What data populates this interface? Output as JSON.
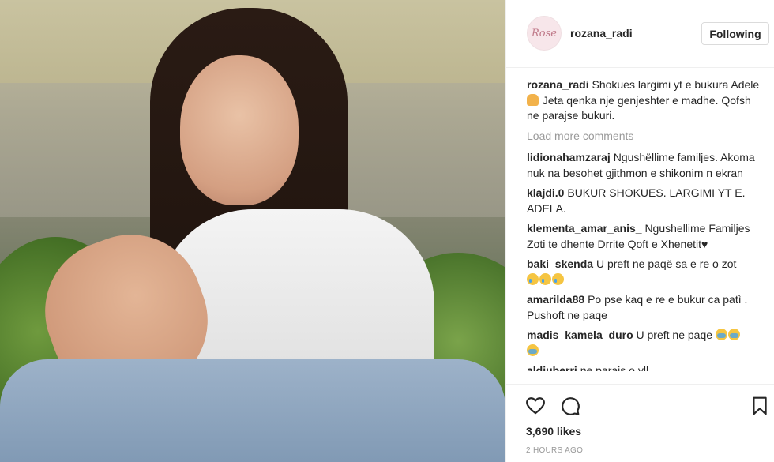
{
  "header": {
    "avatar_text": "Rose",
    "username": "rozana_radi",
    "follow_label": "Following"
  },
  "caption": {
    "author": "rozana_radi",
    "text": "Shokues largimi yt e bukura Adele",
    "text2": "Jeta qenka nje genjeshter e madhe. Qofsh ne parajse bukuri."
  },
  "load_more": "Load more comments",
  "comments": [
    {
      "author": "lidionahamzaraj",
      "text": "Ngushëllime familjes. Akoma nuk na besohet gjithmon e shikonim n ekran"
    },
    {
      "author": "klajdi.0",
      "text": "BUKUR SHOKUES. LARGIMI YT E. ADELA."
    },
    {
      "author": "klementa_amar_anis_",
      "text": "Ngushellime Familjes Zoti te dhente Drrite Qoft e Xhenetit♥"
    },
    {
      "author": "baki_skenda",
      "text": "U preft ne paqë sa e re o zot"
    },
    {
      "author": "amarilda88",
      "text": "Po pse kaq e re e bukur ca patì . Pushoft ne paqe"
    },
    {
      "author": "madis_kamela_duro",
      "text": "U preft ne paqe"
    },
    {
      "author": "aldiuberri",
      "text": "ne parajs o yll"
    }
  ],
  "actions": {
    "likes": "3,690 likes",
    "time": "2 HOURS AGO"
  },
  "icons": [
    "heart-icon",
    "comment-icon",
    "bookmark-icon",
    "praying-emoji",
    "cry-emoji",
    "sob-emoji"
  ],
  "colors": {
    "border": "#efefef",
    "muted": "#999999",
    "text": "#262626"
  }
}
